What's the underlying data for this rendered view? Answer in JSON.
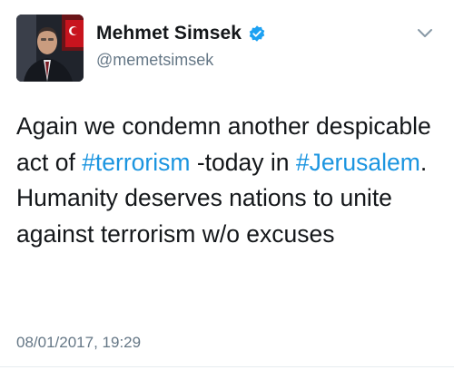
{
  "author": {
    "display_name": "Mehmet Simsek",
    "handle": "@memetsimsek",
    "verified": true
  },
  "icons": {
    "verified": "verified-badge-icon",
    "menu": "chevron-down-icon"
  },
  "colors": {
    "hashtag": "#1b95e0",
    "verified_badge": "#1da1f2",
    "secondary_text": "#657786"
  },
  "tweet": {
    "text_1": "Again we condemn another despicable act of ",
    "hashtag_1": "#terrorism",
    "text_2": " -today in ",
    "hashtag_2": "#Jerusalem",
    "text_3": ". Humanity deserves nations to unite against terrorism w/o excuses"
  },
  "timestamp": "08/01/2017, 19:29"
}
